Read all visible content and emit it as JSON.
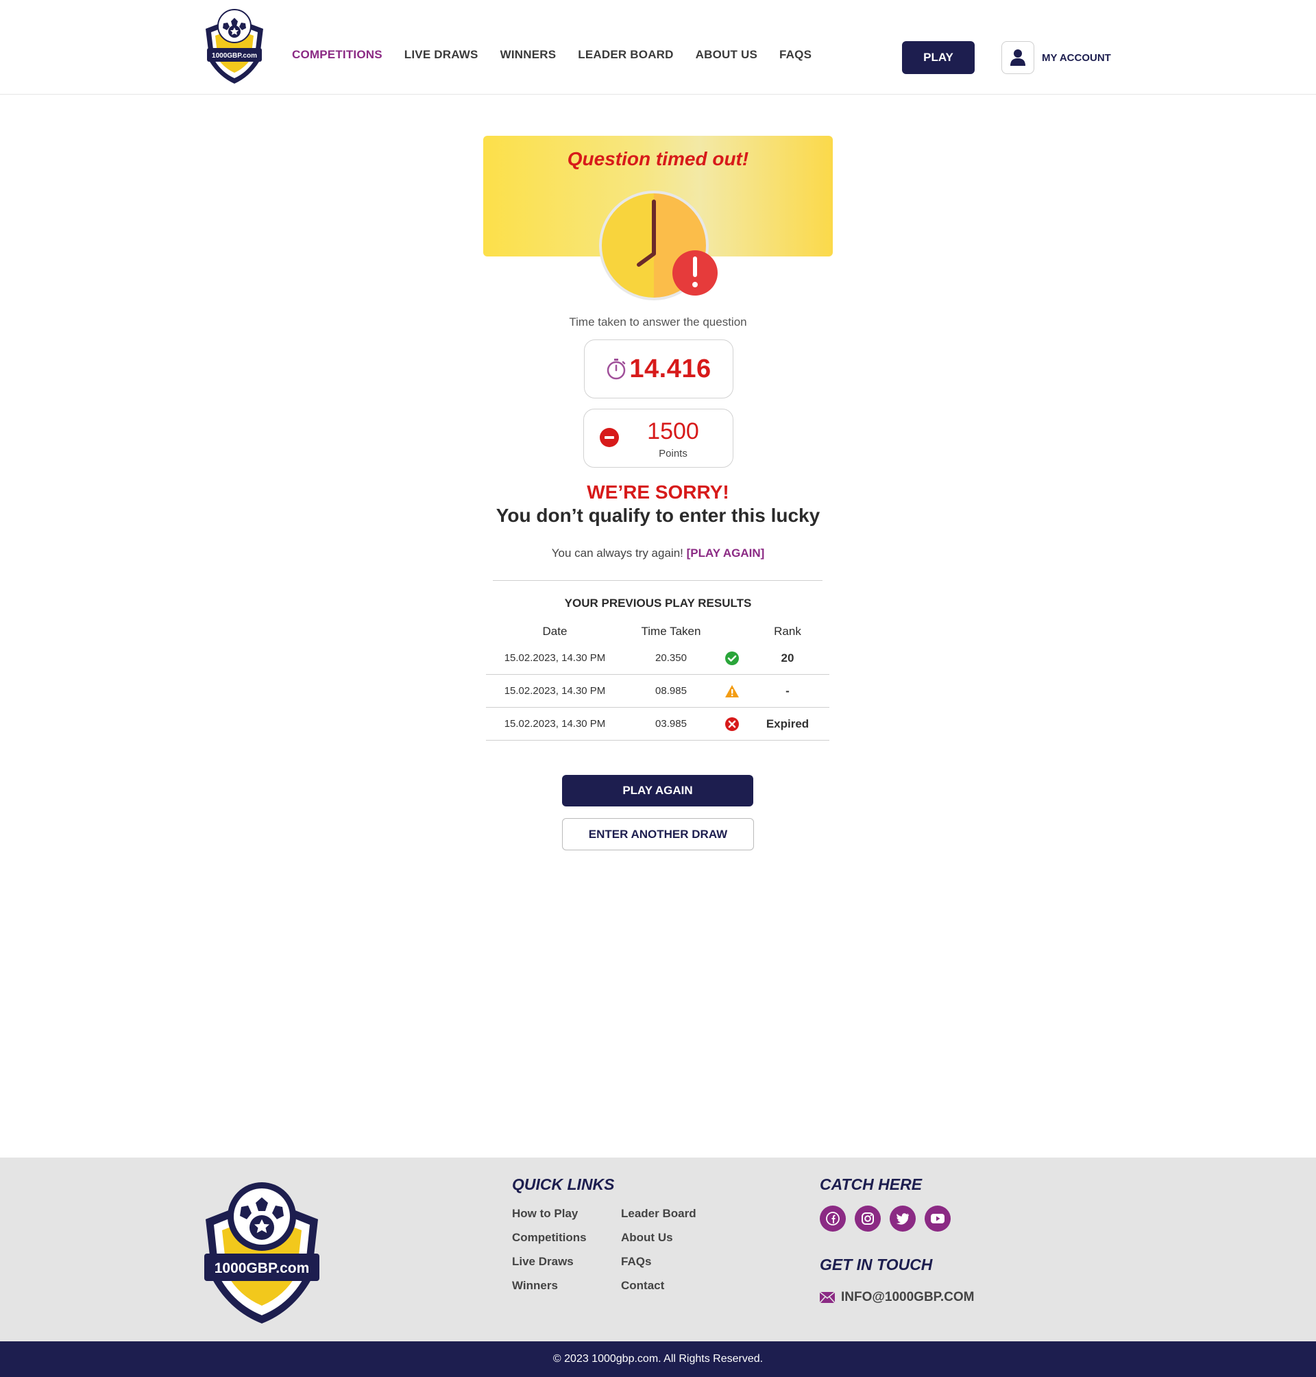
{
  "brand": {
    "name": "1000GBP.com",
    "accent": "#8b2a84",
    "navy": "#1d1e4f",
    "red": "#d71a1a"
  },
  "nav": {
    "items": [
      {
        "label": "COMPETITIONS",
        "active": true
      },
      {
        "label": "LIVE DRAWS"
      },
      {
        "label": "WINNERS"
      },
      {
        "label": "LEADER BOARD"
      },
      {
        "label": "ABOUT US"
      },
      {
        "label": "FAQS"
      }
    ],
    "play": "PLAY",
    "account": "MY ACCOUNT"
  },
  "result": {
    "banner_title": "Question timed out!",
    "time_label": "Time taken to answer the question",
    "time_value": "14.416",
    "points_value": "1500",
    "points_label": "Points",
    "sorry": "WE’RE SORRY!",
    "qualify": "You don’t qualify to enter this lucky",
    "try_text": "You can always try again!",
    "try_link": "[PLAY AGAIN]"
  },
  "history": {
    "title": "YOUR PREVIOUS PLAY RESULTS",
    "columns": [
      "Date",
      "Time Taken",
      "",
      "Rank"
    ],
    "rows": [
      {
        "date": "15.02.2023, 14.30 PM",
        "time": "20.350",
        "status": "check-circle-icon",
        "rank": "20"
      },
      {
        "date": "15.02.2023, 14.30 PM",
        "time": "08.985",
        "status": "warning-icon",
        "rank": "-"
      },
      {
        "date": "15.02.2023, 14.30 PM",
        "time": "03.985",
        "status": "error-circle-icon",
        "rank": "Expired"
      }
    ]
  },
  "actions": {
    "play_again": "PLAY AGAIN",
    "enter_draw": "ENTER ANOTHER DRAW"
  },
  "footer": {
    "quick_links_title": "QUICK LINKS",
    "links_col1": [
      "How to Play",
      "Competitions",
      "Live Draws",
      "Winners"
    ],
    "links_col2": [
      "Leader Board",
      "About Us",
      "FAQs",
      "Contact"
    ],
    "catch_title": "CATCH HERE",
    "social": [
      "facebook-icon",
      "instagram-icon",
      "twitter-icon",
      "youtube-icon"
    ],
    "contact_title": "GET IN TOUCH",
    "email": "INFO@1000GBP.COM",
    "copyright": "© 2023 1000gbp.com. All Rights Reserved."
  }
}
